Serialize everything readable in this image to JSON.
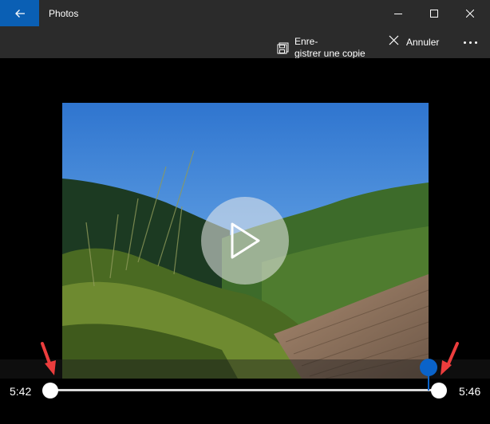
{
  "window": {
    "title": "Photos",
    "back_icon": "back-arrow-icon",
    "minimize_icon": "minimize-icon",
    "maximize_icon": "maximize-icon",
    "close_icon": "close-icon"
  },
  "commands": {
    "save_copy_label": "Enre-\ngistrer une copie",
    "save_copy_icon": "save-copy-icon",
    "cancel_label": "Annuler",
    "cancel_icon": "close-icon",
    "more_icon": "more-icon"
  },
  "player": {
    "play_icon": "play-icon",
    "start_time": "5:42",
    "end_time": "5:46"
  },
  "annotations": {
    "arrow_color": "#ec3d3d"
  },
  "colors": {
    "accent": "#0a5fb4",
    "playhead": "#0a63c9",
    "chrome": "#2b2b2b"
  }
}
